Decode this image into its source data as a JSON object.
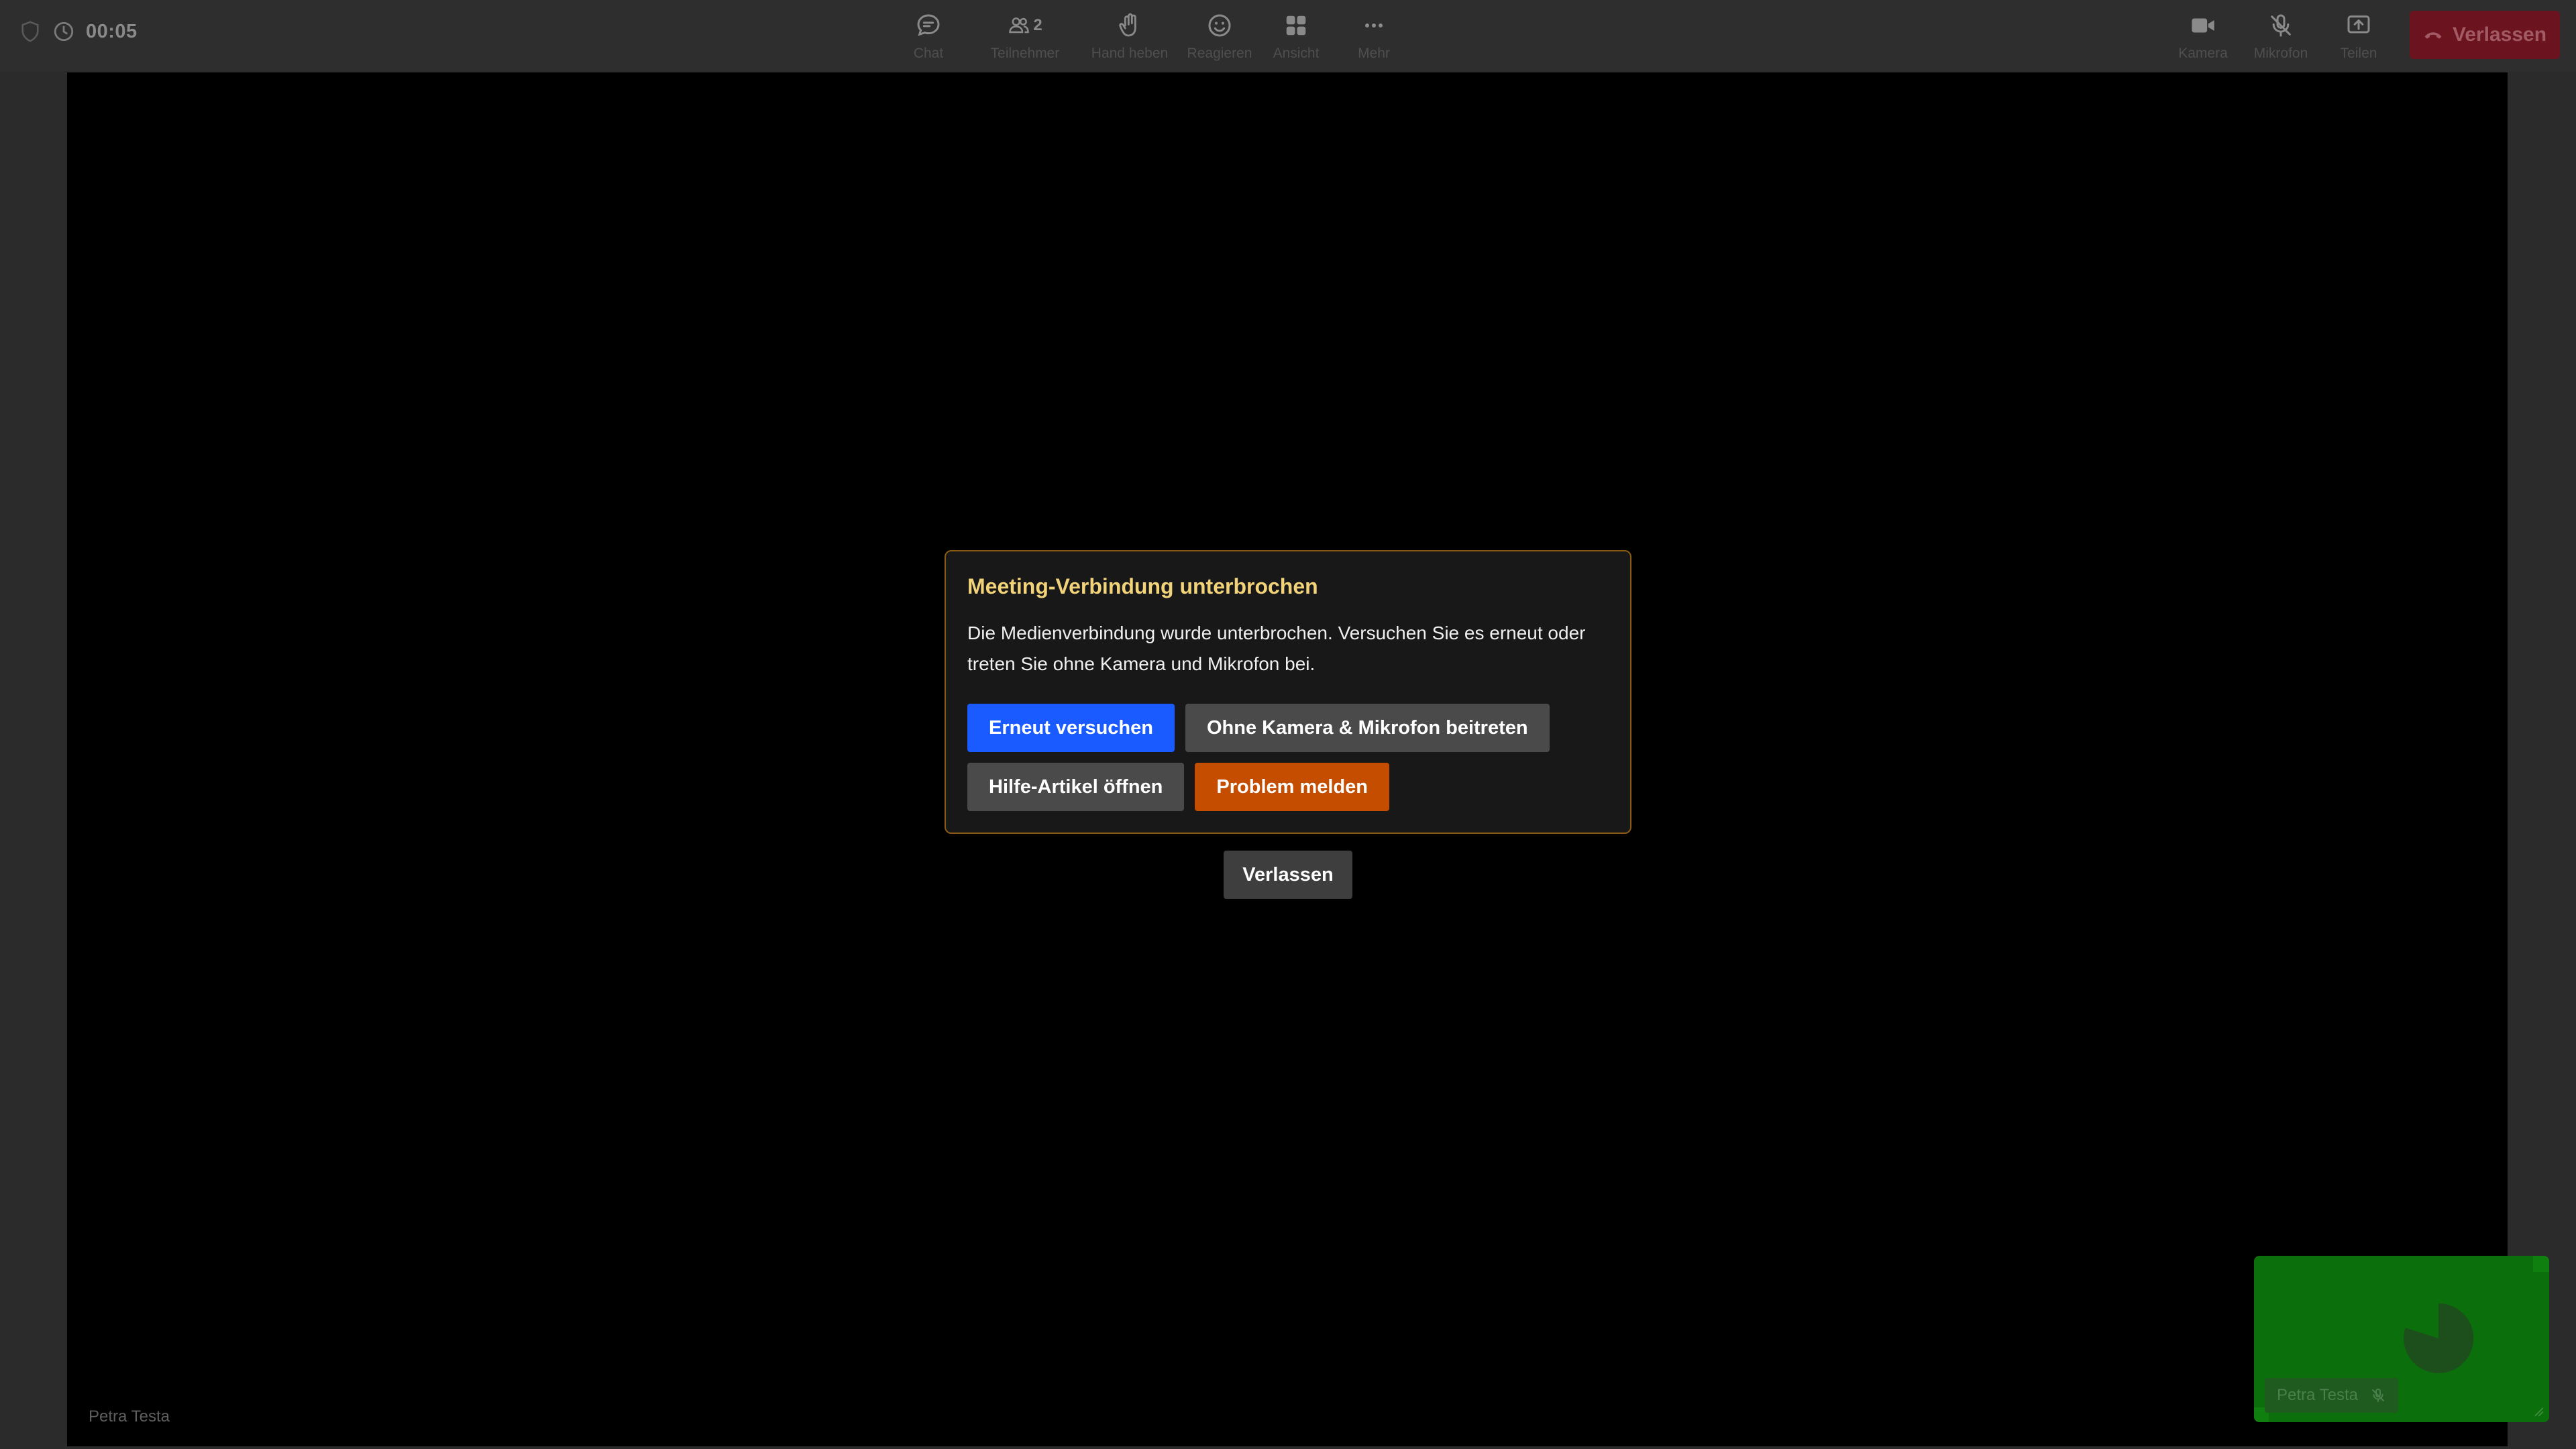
{
  "topbar": {
    "timer": "00:05",
    "center_items": [
      {
        "icon": "chat-icon",
        "label": "Chat"
      },
      {
        "icon": "participants-icon",
        "label": "Teilnehmer",
        "count": "2"
      },
      {
        "icon": "raise-hand-icon",
        "label": "Hand heben"
      },
      {
        "icon": "emoji-icon",
        "label": "Reagieren"
      },
      {
        "icon": "grid-view-icon",
        "label": "Ansicht"
      },
      {
        "icon": "more-icon",
        "label": "Mehr"
      }
    ],
    "right_items": [
      {
        "icon": "camera-icon",
        "label": "Kamera"
      },
      {
        "icon": "mic-off-icon",
        "label": "Mikrofon"
      },
      {
        "icon": "share-screen-icon",
        "label": "Teilen"
      }
    ],
    "leave_label": "Verlassen",
    "leave_color": "#6b1420"
  },
  "stage": {
    "participant_name": "Petra Testa"
  },
  "dialog": {
    "title": "Meeting-Verbindung unterbrochen",
    "message": "Die Medienverbindung wurde unterbrochen. Versuchen Sie es erneut oder treten Sie ohne Kamera und Mikrofon bei.",
    "retry_label": "Erneut versuchen",
    "join_without_media_label": "Ohne Kamera & Mikrofon beitreten",
    "help_label": "Hilfe-Artikel öffnen",
    "report_label": "Problem melden",
    "accent_color": "#1a5bff",
    "warning_color": "#c44d00",
    "title_color": "#f2d37a"
  },
  "leave_center_label": "Verlassen",
  "selfview": {
    "name": "Petra Testa",
    "bg_color": "#0b6f0b"
  }
}
